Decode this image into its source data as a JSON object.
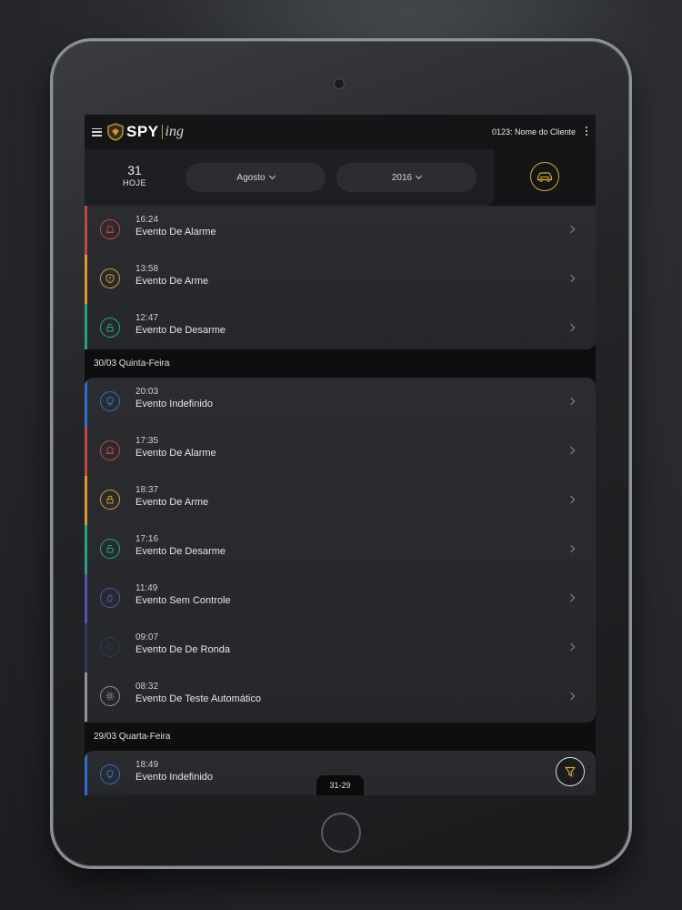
{
  "header": {
    "logo_text": "SPY",
    "logo_script": "ing",
    "client_label": "0123: Nome do Cliente"
  },
  "filters": {
    "today_number": "31",
    "today_label": "HOJE",
    "month": "Agosto",
    "year": "2016"
  },
  "colors": {
    "alarm": "#c9433f",
    "arm": "#d99a2b",
    "disarm": "#24a283",
    "undefined": "#2d6fd0",
    "no_control": "#5a4fb5",
    "round": "#2f3a5a",
    "test": "#8f9196",
    "accent": "#d9a92e"
  },
  "groups": [
    {
      "header": "",
      "events": [
        {
          "time": "16:24",
          "title": "Evento De Alarme",
          "type": "alarm",
          "icon": "alarm-bell-icon"
        },
        {
          "time": "13:58",
          "title": "Evento De Arme",
          "type": "arm",
          "icon": "arm-shield-icon"
        },
        {
          "time": "12:47",
          "title": "Evento De Desarme",
          "type": "disarm",
          "icon": "disarm-lock-icon"
        }
      ]
    },
    {
      "header": "30/03  Quinta-Feira",
      "events": [
        {
          "time": "20:03",
          "title": "Evento Indefinido",
          "type": "undefined",
          "icon": "undefined-bulb-icon"
        },
        {
          "time": "17:35",
          "title": "Evento De Alarme",
          "type": "alarm",
          "icon": "alarm-bell-icon"
        },
        {
          "time": "18:37",
          "title": "Evento De Arme",
          "type": "arm",
          "icon": "arm-lock-icon"
        },
        {
          "time": "17:16",
          "title": "Evento De Desarme",
          "type": "disarm",
          "icon": "disarm-lock-icon"
        },
        {
          "time": "11:49",
          "title": "Evento Sem Controle",
          "type": "no_control",
          "icon": "hand-icon"
        },
        {
          "time": "09:07",
          "title": "Evento De De Ronda",
          "type": "round",
          "icon": "round-icon"
        },
        {
          "time": "08:32",
          "title": "Evento De Teste Automático",
          "type": "test",
          "icon": "gear-icon"
        }
      ]
    },
    {
      "header": "29/03  Quarta-Feira",
      "events": [
        {
          "time": "18:49",
          "title": "Evento Indefinido",
          "type": "undefined",
          "icon": "undefined-bulb-icon"
        }
      ]
    }
  ],
  "pagination": {
    "label": "31-29"
  }
}
